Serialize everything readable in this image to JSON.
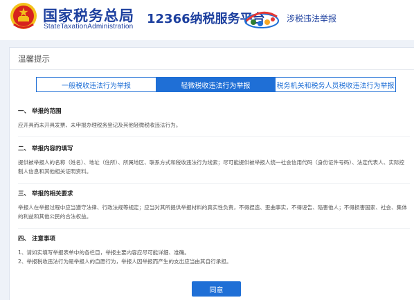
{
  "header": {
    "brand_cn": "国家税务总局",
    "brand_en": "StateTaxationAdministration",
    "platform": "12366纳税服务平台",
    "tag": "涉税违法举报",
    "emblem_icon": "national-emblem",
    "platform_logo_icon": "12366-logo"
  },
  "panel": {
    "title": "温馨提示",
    "tabs": [
      {
        "label": "一般税收违法行为举报",
        "active": false
      },
      {
        "label": "轻微税收违法行为举报",
        "active": true
      },
      {
        "label": "税务机关和税务人员税收违法行为举报",
        "active": false
      }
    ],
    "sections": [
      {
        "heading": "一、 举报的范围",
        "body": [
          "应开具而未开具发票、未申报办理税务登记及其他轻微税收违法行为。"
        ]
      },
      {
        "heading": "二、 举报内容的填写",
        "body": [
          "提供被举报人的名称（姓名）、地址（住所）、所属地区、联系方式和税收违法行为线索；尽可能提供被举报人统一社会信用代码（身份证件号码）、法定代表人、实际控制人信息和其他相关证明资料。"
        ]
      },
      {
        "heading": "三、 举报的相关要求",
        "body": [
          "举报人在举报过程中应当遵守法律、行政法规等规定；应当对其所提供举报材料的真实性负责，不得捏造、歪曲事实，不得诬告、陷害他人；不得损害国家、社会、集体的利益和其他公民的合法权益。"
        ]
      },
      {
        "heading": "四、 注意事项",
        "body": [
          "1、请如实填写举报表单中的各栏目，举报主要内容应尽可能详细、准确。",
          "2、举报税收违法行为是举报人的自愿行为，举报人因举报而产生的支出应当由其自行承担。"
        ]
      }
    ],
    "agree_label": "同意"
  },
  "colors": {
    "brand_blue": "#1c3f9e",
    "accent_blue": "#1f6fd6",
    "emblem_red": "#d7231d",
    "emblem_gold": "#f3c21b"
  }
}
